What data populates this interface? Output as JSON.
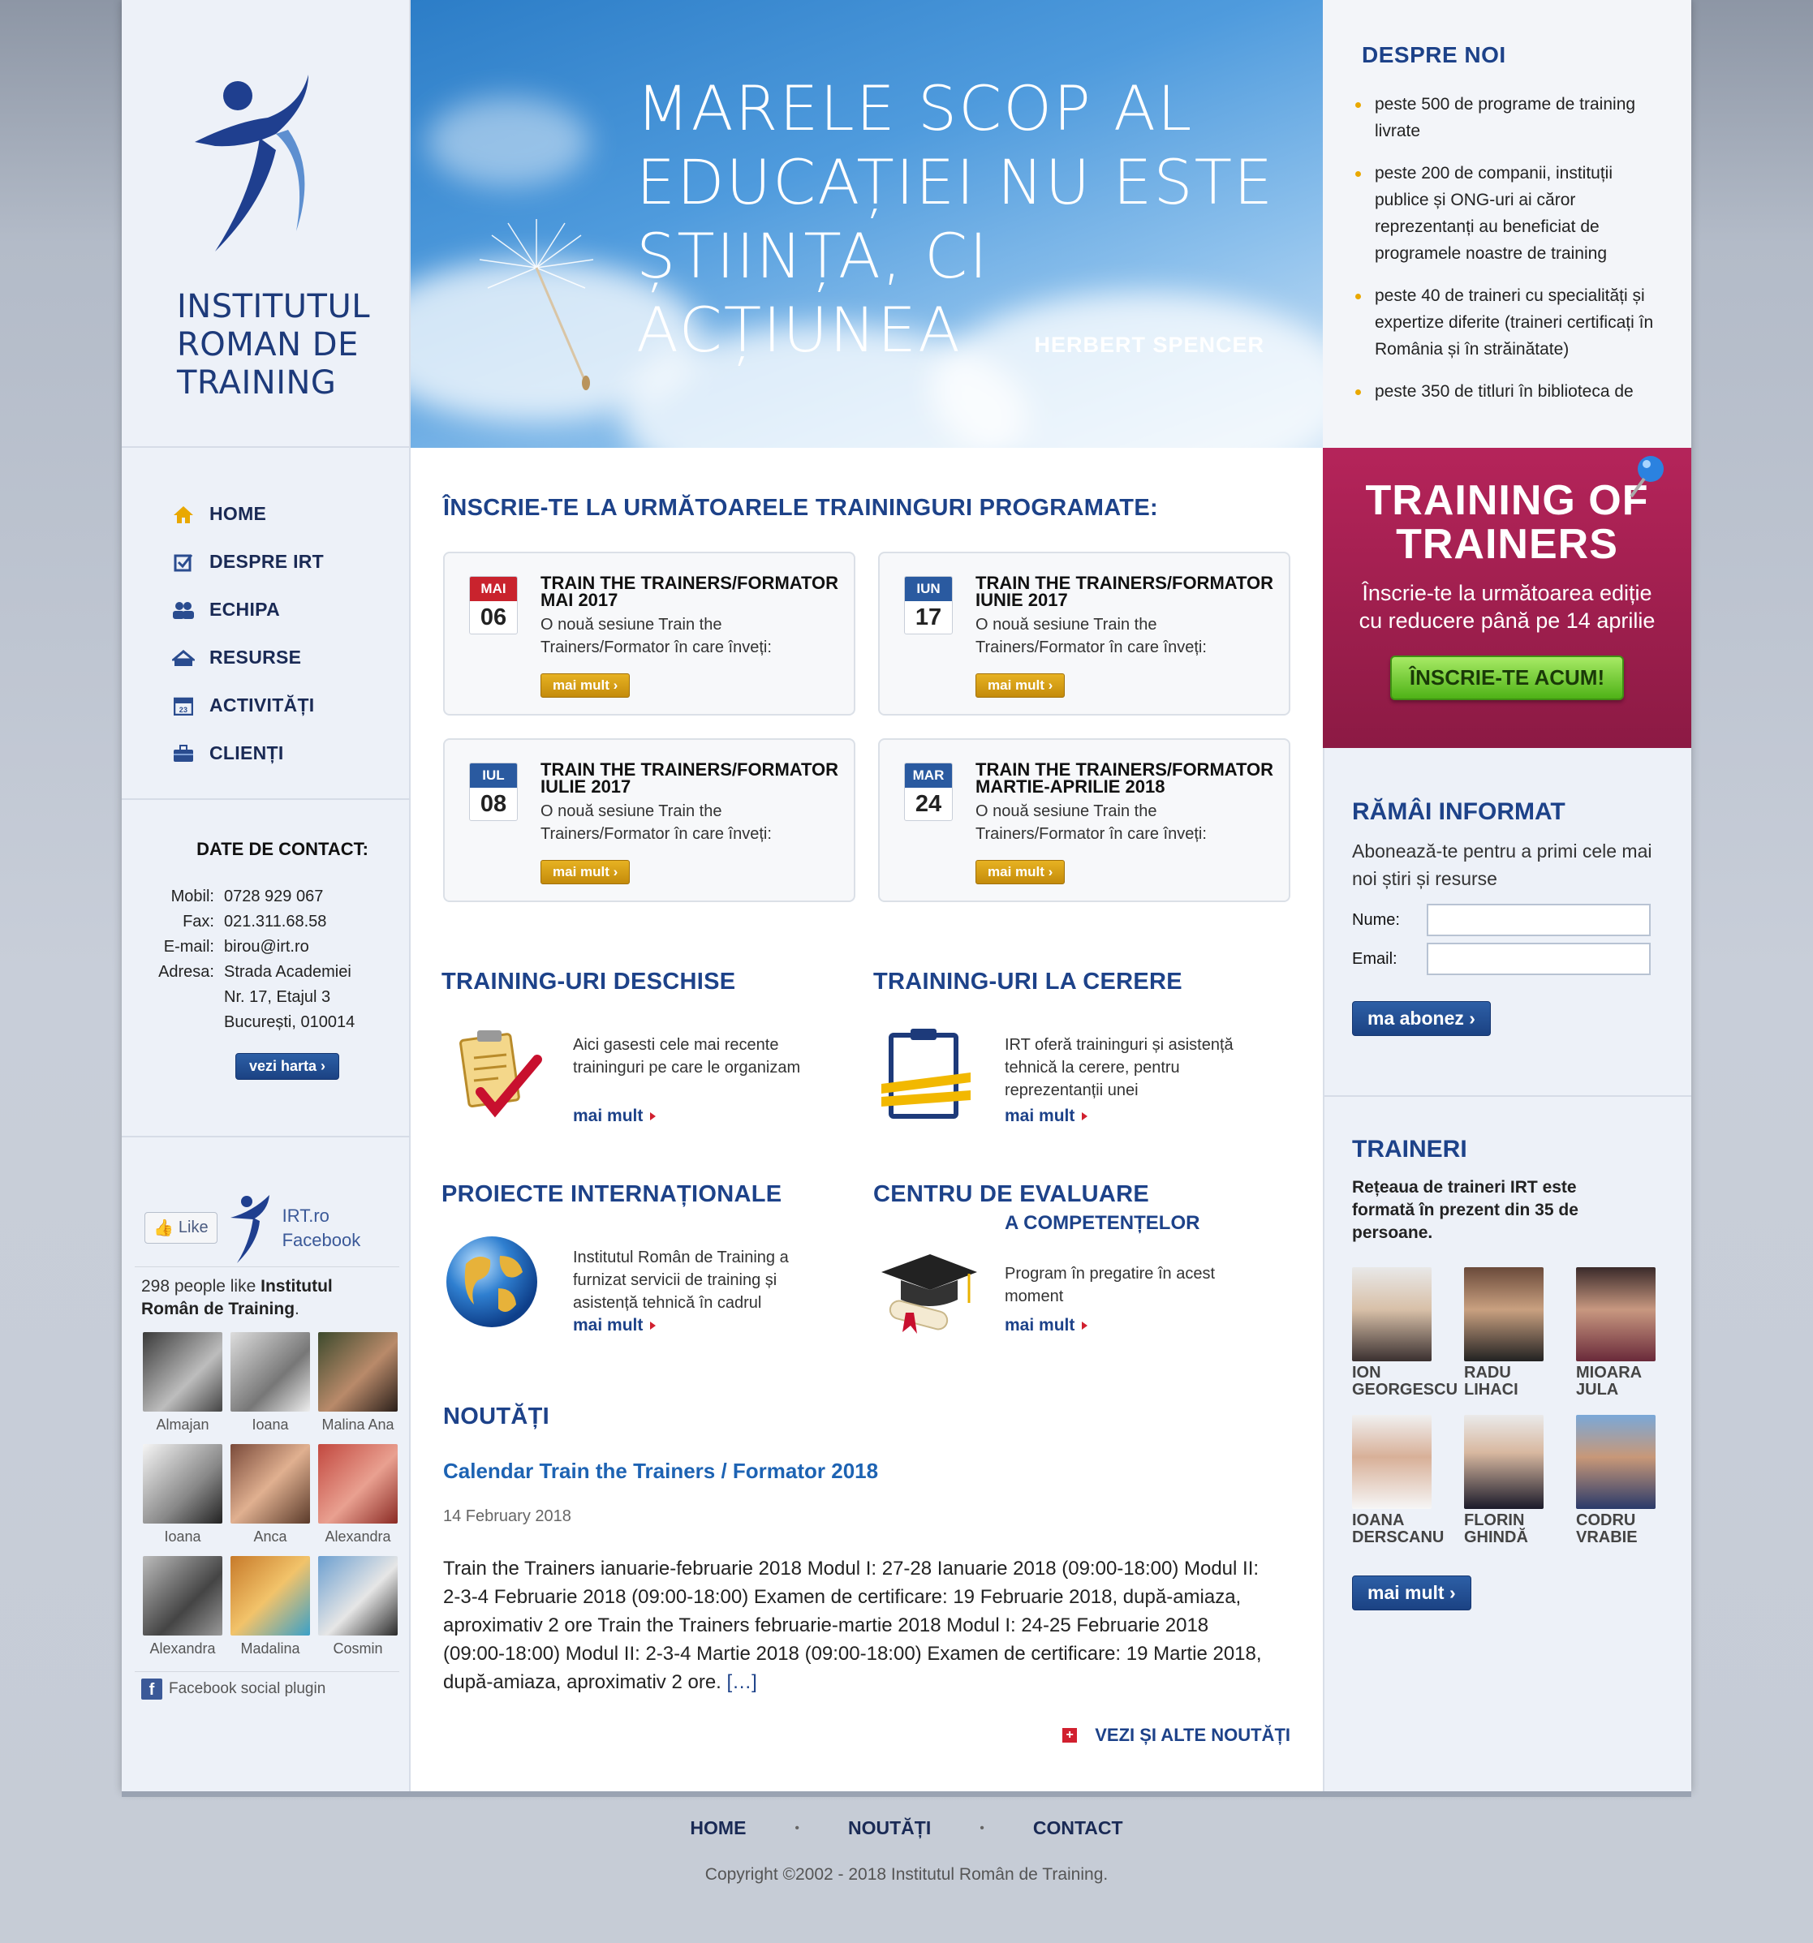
{
  "logo": {
    "text_line1": "INSTITUTUL",
    "text_line2": "ROMAN DE",
    "text_line3": "TRAINING"
  },
  "hero": {
    "quote_line1": "MARELE SCOP AL",
    "quote_line2": "EDUCAȚIEI NU ESTE",
    "quote_line3": "ȘTIINȚA, CI ACȚIUNEA",
    "author": "HERBERT SPENCER"
  },
  "despre": {
    "title": "DESPRE NOI",
    "items": [
      "peste 500 de programe de training livrate",
      "peste 200 de companii, instituții publice și ONG-uri ai căror reprezentanți au beneficiat de programele noastre de training",
      "peste 40 de traineri cu specialități și expertize diferite (traineri certificați în România și în străinătate)",
      "peste 350 de titluri în biblioteca de"
    ]
  },
  "nav": {
    "items": [
      "HOME",
      "DESPRE IRT",
      "ECHIPA",
      "RESURSE",
      "ACTIVITĂȚI",
      "CLIENȚI"
    ]
  },
  "contact": {
    "title": "DATE DE CONTACT:",
    "mobil_label": "Mobil:",
    "mobil": "0728 929 067",
    "fax_label": "Fax:",
    "fax": "021.311.68.58",
    "email_label": "E-mail:",
    "email": "birou@irt.ro",
    "adresa_label": "Adresa:",
    "adresa1": "Strada Academiei",
    "adresa2": "Nr. 17, Etajul 3",
    "adresa3": "București, 010014",
    "map_button": "vezi harta"
  },
  "facebook": {
    "like": "Like",
    "page_name1": "IRT.ro",
    "page_name2": "Facebook",
    "count_prefix": "298 people like",
    "count_page": "Institutul Român de Training",
    "fans": [
      "Almajan",
      "Ioana",
      "Malina Ana",
      "Ioana",
      "Anca",
      "Alexandra",
      "Alexandra",
      "Madalina",
      "Cosmin"
    ],
    "plugin": "Facebook social plugin"
  },
  "main": {
    "title": "ÎNSCRIE-TE LA URMĂTOARELE TRAININGURI PROGRAMATE:",
    "cards": [
      {
        "month": "MAI",
        "day": "06",
        "title": "TRAIN THE TRAINERS/FORMATOR MAI 2017",
        "desc": "O nouă sesiune Train the Trainers/Formator în care înveți:",
        "btn": "mai mult"
      },
      {
        "month": "IUN",
        "day": "17",
        "title": "TRAIN THE TRAINERS/FORMATOR IUNIE 2017",
        "desc": "O nouă sesiune Train the Trainers/Formator în care înveți:",
        "btn": "mai mult"
      },
      {
        "month": "IUL",
        "day": "08",
        "title": "TRAIN THE TRAINERS/FORMATOR IULIE 2017",
        "desc": "O nouă sesiune Train the Trainers/Formator în care înveți:",
        "btn": "mai mult"
      },
      {
        "month": "MAR",
        "day": "24",
        "title": "TRAIN THE TRAINERS/FORMATOR MARTIE-APRILIE 2018",
        "desc": "O nouă sesiune Train the Trainers/Formator în care înveți:",
        "btn": "mai mult"
      }
    ],
    "blocks": [
      {
        "title": "TRAINING-URI DESCHISE",
        "subtitle": "",
        "desc": "Aici gasesti cele mai recente traininguri pe care le organizam",
        "link": "mai mult"
      },
      {
        "title": "TRAINING-URI LA CERERE",
        "subtitle": "",
        "desc": "IRT oferă traininguri și asistență tehnică la cerere, pentru reprezentanții unei",
        "link": "mai mult"
      },
      {
        "title": "PROIECTE INTERNAȚIONALE",
        "subtitle": "",
        "desc": "Institutul Român de Training a furnizat servicii de training și asistență tehnică în cadrul",
        "link": "mai mult"
      },
      {
        "title": "CENTRU DE EVALUARE",
        "subtitle": "A COMPETENȚELOR",
        "desc": "Program în pregatire în acest moment",
        "link": "mai mult"
      }
    ],
    "news": {
      "title": "NOUTĂȚI",
      "item_title": "Calendar Train the Trainers / Formator 2018",
      "item_date": "14 February 2018",
      "item_body": "Train the Trainers ianuarie-februarie 2018 Modul I: 27-28 Ianuarie 2018 (09:00-18:00) Modul II: 2-3-4 Februarie 2018 (09:00-18:00) Examen de certificare: 19 Februarie 2018, după-amiaza, aproximativ 2 ore   Train the Trainers februarie-martie 2018 Modul I: 24-25 Februarie 2018 (09:00-18:00) Modul II: 2-3-4 Martie 2018 (09:00-18:00) Examen de certificare: 19 Martie 2018, după-amiaza, aproximativ 2 ore.",
      "item_more": "[…]",
      "more_link": "VEZI ȘI ALTE NOUTĂȚI"
    }
  },
  "tot": {
    "title1": "TRAINING OF",
    "title2": "TRAINERS",
    "desc1": "Înscrie-te la următoarea ediție",
    "desc2": "cu reducere până pe 14 aprilie",
    "cta": "ÎNSCRIE-TE ACUM!"
  },
  "newsletter": {
    "title": "RĂMÂI INFORMAT",
    "desc": "Abonează-te pentru a primi cele mai noi știri și resurse",
    "name_label": "Nume:",
    "email_label": "Email:",
    "button": "ma abonez"
  },
  "trainers": {
    "title": "TRAINERI",
    "desc": "Rețeaua de traineri IRT este formată în prezent din 35 de persoane.",
    "list": [
      {
        "first": "ION",
        "last": "GEORGESCU"
      },
      {
        "first": "RADU",
        "last": "LIHACI"
      },
      {
        "first": "MIOARA",
        "last": "JULA"
      },
      {
        "first": "IOANA",
        "last": "DERSCANU"
      },
      {
        "first": "FLORIN",
        "last": "GHINDĂ"
      },
      {
        "first": "CODRU",
        "last": "VRABIE"
      }
    ],
    "button": "mai mult"
  },
  "footer": {
    "links": [
      "HOME",
      "NOUTĂȚI",
      "CONTACT"
    ],
    "copyright": "Copyright ©2002 - 2018 Institutul Român de Training."
  },
  "colors": {
    "brand_blue": "#1d4289",
    "accent_red": "#b5245a",
    "cta_green": "#4fb217",
    "button_gold": "#c48b0b"
  }
}
